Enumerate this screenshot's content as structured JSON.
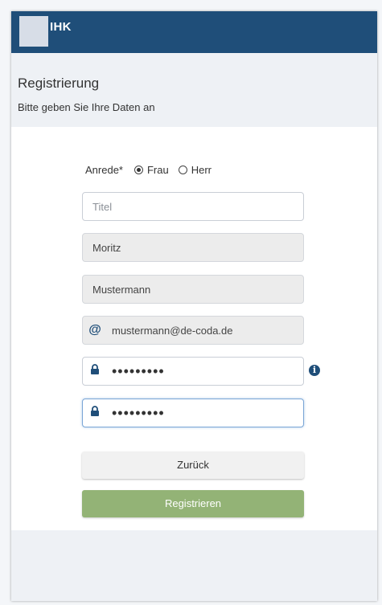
{
  "app": {
    "logo_text": "IHK"
  },
  "header": {
    "title": "Registrierung",
    "subtitle": "Bitte geben Sie Ihre Daten an"
  },
  "form": {
    "anrede": {
      "label": "Anrede*",
      "options": [
        {
          "label": "Frau",
          "selected": true
        },
        {
          "label": "Herr",
          "selected": false
        }
      ]
    },
    "title_field": {
      "placeholder": "Titel",
      "value": ""
    },
    "first_name": {
      "value": "Moritz"
    },
    "last_name": {
      "value": "Mustermann"
    },
    "email": {
      "value": "mustermann@de-coda.de",
      "icon": "at-icon"
    },
    "password": {
      "value": "•••••••••",
      "icon": "lock-icon"
    },
    "password_confirm": {
      "value": "•••••••••",
      "icon": "lock-icon"
    },
    "info_icon": "info-icon"
  },
  "buttons": {
    "back_label": "Zurück",
    "register_label": "Registrieren"
  },
  "colors": {
    "brand": "#1f4e79",
    "register_button": "#93b376",
    "header_bg": "#eef1f5"
  }
}
